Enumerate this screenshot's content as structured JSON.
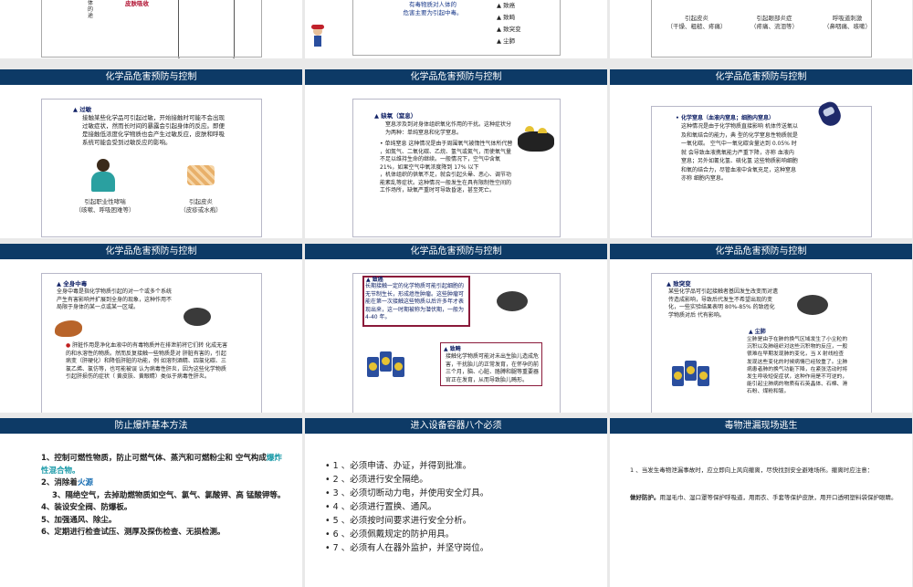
{
  "slides": {
    "r0c0": {
      "left_text": "体的途",
      "red_text": "皮肤吸收"
    },
    "r0c1": {
      "center_text": "有毒物质对人体的\n危害主要为引起中毒。",
      "bullets": [
        "致癌",
        "致畸",
        "致突变",
        "尘肺"
      ]
    },
    "r0c2": {
      "captions": [
        "引起皮炎\n（干燥、粗糙、疼痛）",
        "引起眼部炎症\n（疼痛、流泪等）",
        "呼吸道刺激\n（鼻咽痛、咳嗽）"
      ]
    },
    "r1c0": {
      "header": "化学品危害预防与控制",
      "title": "过敏",
      "body": "接触某些化学品可引起过敏，开始接触时可能不会出现过敏症状，然而长时间的暴露会引起身体的反应。即便是接触低浓度化学物质也会产生过敏反应，皮肤和呼吸系统可能会受到过敏反应的影响。",
      "captions": [
        "引起职业性哮喘\n（咳嗽、呼吸困难等）",
        "引起皮炎\n（皮疹或水疱）"
      ]
    },
    "r1c1": {
      "header": "化学品危害预防与控制",
      "title": "缺氧（窒息）",
      "body1": "窒息涉及到对身体组织氧化作用的干扰。这种症状分为两种：单纯窒息和化学窒息。",
      "body2": "单纯窒息 这种情况是由于周围氧气被惰性气体所代替\n，如氮气、二氧化碳、乙烷、氢气或氦气，而使氧气量不足以维持生命的继续。一般情况下，空气中含氧 21%，如果空气中氧浓度降到 17% 以下\n，机体组织的供氧不足，就会引起头晕、恶心、调节功能紊乱等症状。这种情况一般发生在具有限制性空间的工作场所，缺氧严重时可导致昏迷，甚至死亡。"
    },
    "r1c2": {
      "header": "化学品危害预防与控制",
      "title": "化学窒息（血液内窒息；细胞内窒息）",
      "body": "这种情况是由于化学物质直接影响 机体传送氧以及和氧结合的能力，典 型的化学窒息性物质就是一氧化碳。 空气中一氧化碳含量达到 0.05% 时就 会导致血液携氧能力严重下降，亦称 血液内窒息；另外如氰化氢、硫化氢 这些物质影响细胞和氧的结合力，尽管血液中含氧充足，这种窒息亦称 细胞内窒息。"
    },
    "r2c0": {
      "header": "化学品危害预防与控制",
      "title": "全身中毒",
      "body1": "全身中毒是指化学物质引起的对一个或多个系统产生有害影响并扩展到全身的现象，这种作用不 局限于身体的某一点或某一区域。",
      "body2": "肝脏作用是净化血液中的有毒物质并在排泄前将它们转 化成无害的和水溶性的物质。然而反复接触一些物质是对 肝脏有害的，引起病变（肝硬化）和降低肝脏的功能，例 如溶剂酒精、四氯化碳、三氯乙烯、氯仿等，也可能被误 认为病毒性肝炎，因为这些化学物质引起肝损伤的症状（ 黄皮肤、黄眼睛）类似于病毒性肝炎。"
    },
    "r2c1": {
      "header": "化学品危害预防与控制",
      "title": "致癌",
      "body1": "长期接触一定的化学物质可能引起细胞的无节制生长，形成癌性肿瘤。这些肿瘤可能在第一次接触这些物质以后许多年才表现出来，这一时期被称为潜伏期，一般为 4-40 年。",
      "title2": "致畸",
      "body2": "接触化学物质可能对未出生胎儿造成危害，干扰胎儿的正常发育，在怀孕的前三个月，脑、心脏、胳膊和腿等重要器官正在发育，从而导致胎儿畸形。"
    },
    "r2c2": {
      "header": "化学品危害预防与控制",
      "title": "致突变",
      "body1": "某些化学品可引起接触者基因发生改变而对遗传造成影响，导致后代发生不希望出现的变化，一些实验结果表明 80%-85% 的致癌化学物质对后 代有影响。",
      "title2": "尘肺",
      "body2": "尘肺是由于在肺的换气区域发生了小尘粒的沉积以及肺组织对这些沉积物的反应，一般很难在早期发现肺的变化，当 X 射线检查 发现这些变化的时候病情已经较重了。尘肺 病患者肺的换气功能下降，在紧张活动时将 发生呼吸短促症状，这种作用是不可逆的，能引起尘肺病的物质有石英晶体、石棉、滑 石粉、煤粉和铍。"
    },
    "r3c0": {
      "header": "防止爆炸基本方法",
      "items": [
        {
          "num": "1、",
          "text": "控制可燃性物质，防止可燃气体、蒸汽和可燃粉尘和 空气构成",
          "hl": "爆炸性混合物。"
        },
        {
          "num": "2、",
          "text": "消除着",
          "hl": "火源"
        },
        {
          "num": "3、",
          "text": "隔绝空气，去掉助燃物质如空气、氯气、氯酸钾、高 锰酸钾等。",
          "hl": ""
        },
        {
          "num": "4、",
          "text": "装设安全阀、防爆板。",
          "hl": ""
        },
        {
          "num": "5、",
          "text": "加强通风、除尘。",
          "hl": ""
        },
        {
          "num": "6、",
          "text": "定期进行检查试压、测厚及探伤检查、无损检测。",
          "hl": ""
        }
      ]
    },
    "r3c1": {
      "header": "进入设备容器八个必须",
      "items": [
        "1 、必须申请、办证，并得到批准。",
        "2 、必须进行安全隔绝。",
        "3 、必须切断动力电，并使用安全灯具。",
        "4 、必须进行置换、通风。",
        "5 、必须按时间要求进行安全分析。",
        "6 、必须佩戴规定的防护用具。",
        "7 、必须有人在器外监护，并坚守岗位。"
      ]
    },
    "r3c2": {
      "header": "毒物泄漏现场逃生",
      "item1": "1 、当发生毒物泄漏事故时，应立即向上风向撤离，尽快找到安全避难场所。撤离时应注意：",
      "item2_bold": "做好防护。",
      "item2": "用湿毛巾、湿口罩等保护呼吸道，用雨衣、手套等保护皮肤，用开口透明塑料袋保护眼睛。"
    }
  }
}
